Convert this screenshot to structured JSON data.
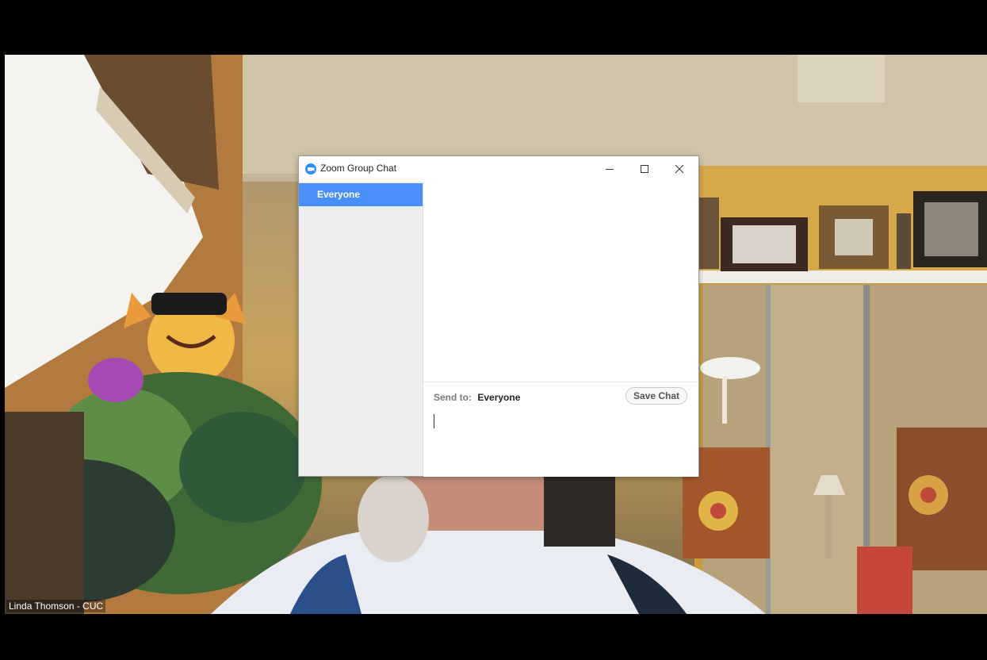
{
  "video": {
    "participant_name": "Linda Thomson - CUC"
  },
  "chat_window": {
    "title": "Zoom Group Chat",
    "icon": "zoom-logo-icon",
    "controls": [
      "minimize-icon",
      "maximize-icon",
      "close-icon"
    ],
    "sidebar": {
      "items": [
        {
          "label": "Everyone",
          "selected": true
        }
      ]
    },
    "composer": {
      "send_to_label": "Send to:",
      "send_to_value": "Everyone",
      "save_chat_label": "Save Chat",
      "input_value": ""
    }
  },
  "colors": {
    "accent": "#4a8ef8",
    "sidebar_bg": "#eeeeee"
  }
}
